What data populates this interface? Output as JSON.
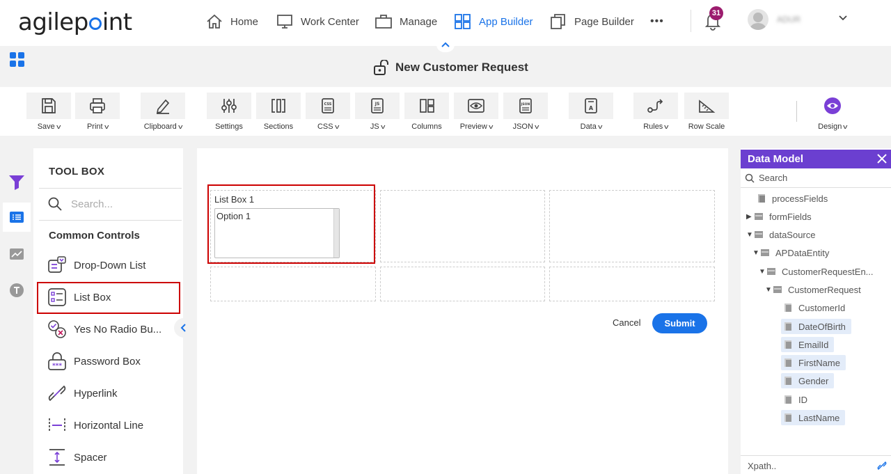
{
  "brand": {
    "logo_text_pre": "agilep",
    "logo_text_post": "int"
  },
  "nav": {
    "home": "Home",
    "work_center": "Work Center",
    "manage": "Manage",
    "app_builder": "App Builder",
    "page_builder": "Page Builder",
    "more": "•••",
    "notifications_count": "31",
    "username": "ADUR"
  },
  "form": {
    "title": "New Customer Request"
  },
  "toolbar": {
    "save": "Save",
    "print": "Print",
    "clipboard": "Clipboard",
    "settings": "Settings",
    "sections": "Sections",
    "css": "CSS",
    "js": "JS",
    "columns": "Columns",
    "preview": "Preview",
    "json": "JSON",
    "data": "Data",
    "rules": "Rules",
    "row_scale": "Row Scale",
    "design": "Design"
  },
  "toolbox": {
    "title": "TOOL BOX",
    "search_placeholder": "Search...",
    "section": "Common Controls",
    "items": [
      {
        "label": "Drop-Down List"
      },
      {
        "label": "List Box"
      },
      {
        "label": "Yes No Radio Bu..."
      },
      {
        "label": "Password Box"
      },
      {
        "label": "Hyperlink"
      },
      {
        "label": "Horizontal Line"
      },
      {
        "label": "Spacer"
      }
    ]
  },
  "canvas": {
    "listbox_label": "List Box 1",
    "listbox_option": "Option 1",
    "cancel": "Cancel",
    "submit": "Submit"
  },
  "data_model": {
    "title": "Data Model",
    "search_label": "Search",
    "xpath_placeholder": "Xpath..",
    "nodes": [
      {
        "label": "processFields"
      },
      {
        "label": "formFields"
      },
      {
        "label": "dataSource"
      },
      {
        "label": "APDataEntity"
      },
      {
        "label": "CustomerRequestEn..."
      },
      {
        "label": "CustomerRequest"
      },
      {
        "label": "CustomerId"
      },
      {
        "label": "DateOfBirth"
      },
      {
        "label": "EmailId"
      },
      {
        "label": "FirstName"
      },
      {
        "label": "Gender"
      },
      {
        "label": "ID"
      },
      {
        "label": "LastName"
      }
    ]
  },
  "colors": {
    "accent": "#1a73e8",
    "data_model_header": "#6b3fd0",
    "highlight": "#cc0000",
    "badge": "#9c1c6e"
  }
}
